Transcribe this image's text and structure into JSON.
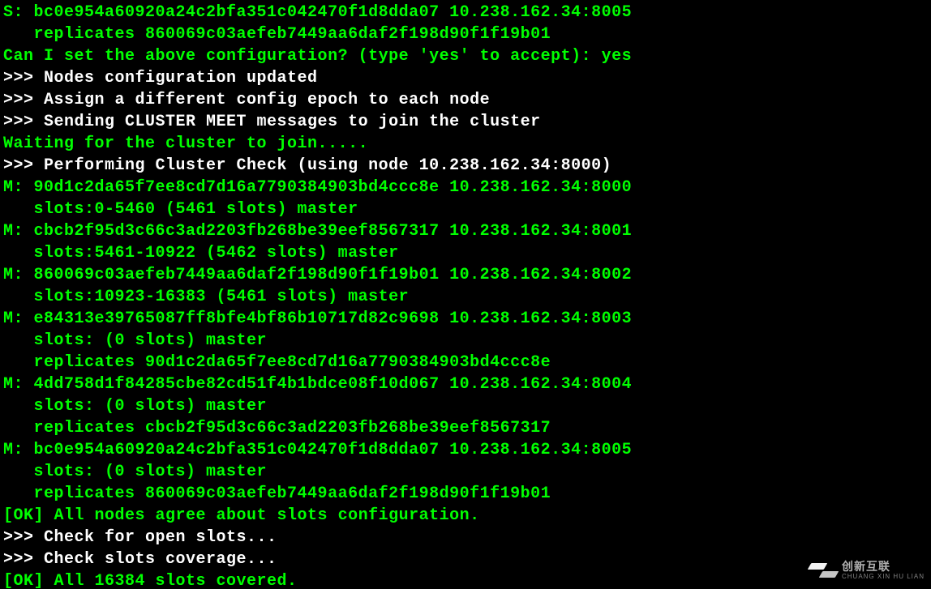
{
  "lines": [
    {
      "segments": [
        {
          "cls": "green",
          "text": "S: bc0e954a60920a24c2bfa351c042470f1d8dda07 10.238.162.34:8005"
        }
      ]
    },
    {
      "segments": [
        {
          "cls": "green",
          "text": "   replicates 860069c03aefeb7449aa6daf2f198d90f1f19b01"
        }
      ]
    },
    {
      "segments": [
        {
          "cls": "green",
          "text": "Can I set the above configuration? (type 'yes' to accept): yes"
        }
      ]
    },
    {
      "segments": [
        {
          "cls": "white",
          "text": ">>> Nodes configuration updated"
        }
      ]
    },
    {
      "segments": [
        {
          "cls": "white",
          "text": ">>> Assign a different config epoch to each node"
        }
      ]
    },
    {
      "segments": [
        {
          "cls": "white",
          "text": ">>> Sending CLUSTER MEET messages to join the cluster"
        }
      ]
    },
    {
      "segments": [
        {
          "cls": "green",
          "text": "Waiting for the cluster to join....."
        }
      ]
    },
    {
      "segments": [
        {
          "cls": "white",
          "text": ">>> Performing Cluster Check (using node 10.238.162.34:8000)"
        }
      ]
    },
    {
      "segments": [
        {
          "cls": "green",
          "text": "M: 90d1c2da65f7ee8cd7d16a7790384903bd4ccc8e 10.238.162.34:8000"
        }
      ]
    },
    {
      "segments": [
        {
          "cls": "green",
          "text": "   slots:0-5460 (5461 slots) master"
        }
      ]
    },
    {
      "segments": [
        {
          "cls": "green",
          "text": "M: cbcb2f95d3c66c3ad2203fb268be39eef8567317 10.238.162.34:8001"
        }
      ]
    },
    {
      "segments": [
        {
          "cls": "green",
          "text": "   slots:5461-10922 (5462 slots) master"
        }
      ]
    },
    {
      "segments": [
        {
          "cls": "green",
          "text": "M: 860069c03aefeb7449aa6daf2f198d90f1f19b01 10.238.162.34:8002"
        }
      ]
    },
    {
      "segments": [
        {
          "cls": "green",
          "text": "   slots:10923-16383 (5461 slots) master"
        }
      ]
    },
    {
      "segments": [
        {
          "cls": "green",
          "text": "M: e84313e39765087ff8bfe4bf86b10717d82c9698 10.238.162.34:8003"
        }
      ]
    },
    {
      "segments": [
        {
          "cls": "green",
          "text": "   slots: (0 slots) master"
        }
      ]
    },
    {
      "segments": [
        {
          "cls": "green",
          "text": "   replicates 90d1c2da65f7ee8cd7d16a7790384903bd4ccc8e"
        }
      ]
    },
    {
      "segments": [
        {
          "cls": "green",
          "text": "M: 4dd758d1f84285cbe82cd51f4b1bdce08f10d067 10.238.162.34:8004"
        }
      ]
    },
    {
      "segments": [
        {
          "cls": "green",
          "text": "   slots: (0 slots) master"
        }
      ]
    },
    {
      "segments": [
        {
          "cls": "green",
          "text": "   replicates cbcb2f95d3c66c3ad2203fb268be39eef8567317"
        }
      ]
    },
    {
      "segments": [
        {
          "cls": "green",
          "text": "M: bc0e954a60920a24c2bfa351c042470f1d8dda07 10.238.162.34:8005"
        }
      ]
    },
    {
      "segments": [
        {
          "cls": "green",
          "text": "   slots: (0 slots) master"
        }
      ]
    },
    {
      "segments": [
        {
          "cls": "green",
          "text": "   replicates 860069c03aefeb7449aa6daf2f198d90f1f19b01"
        }
      ]
    },
    {
      "segments": [
        {
          "cls": "green",
          "text": "[OK] All nodes agree about slots configuration."
        }
      ]
    },
    {
      "segments": [
        {
          "cls": "white",
          "text": ">>> Check for open slots..."
        }
      ]
    },
    {
      "segments": [
        {
          "cls": "white",
          "text": ">>> Check slots coverage..."
        }
      ]
    },
    {
      "segments": [
        {
          "cls": "green",
          "text": "[OK] All 16384 slots covered."
        }
      ]
    }
  ],
  "watermark": {
    "cn": "创新互联",
    "en": "CHUANG XIN HU LIAN"
  }
}
